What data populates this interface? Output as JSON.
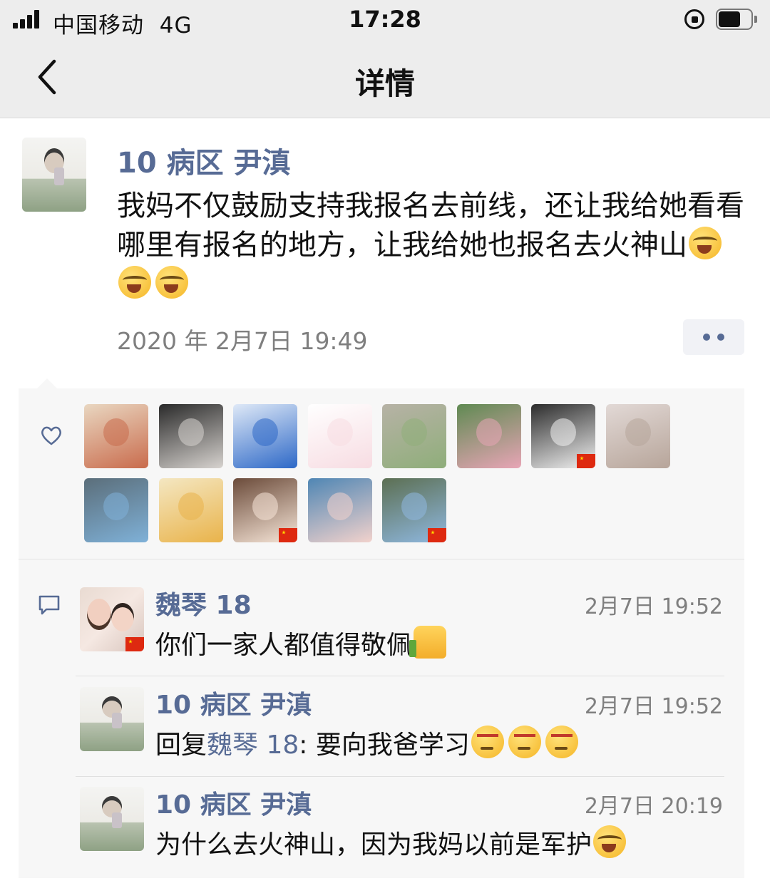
{
  "status_bar": {
    "carrier": "中国移动",
    "network": "4G",
    "time": "17:28"
  },
  "nav": {
    "title": "详情"
  },
  "post": {
    "author": "10 病区 尹滇",
    "text_main": "我妈不仅鼓励支持我报名去前线，还让我给她看看哪里有报名的地方，让我给她也报名去火神山",
    "emojis": [
      "cry-laugh",
      "cry-laugh",
      "cry-laugh"
    ],
    "timestamp": "2020 年 2月7日 19:49"
  },
  "likes": {
    "count_shown": 13,
    "avatars": [
      {
        "id": "like-1",
        "colors": [
          "#c96b4c",
          "#e9d7c1"
        ]
      },
      {
        "id": "like-2",
        "colors": [
          "#d7d3cf",
          "#2a2a2a"
        ]
      },
      {
        "id": "like-3",
        "colors": [
          "#2d68c7",
          "#dfe9f7"
        ]
      },
      {
        "id": "like-4",
        "colors": [
          "#f7dce2",
          "#ffffff"
        ]
      },
      {
        "id": "like-5",
        "colors": [
          "#8fae7a",
          "#b7b2a6"
        ]
      },
      {
        "id": "like-6",
        "colors": [
          "#e8a5b6",
          "#5f8a52"
        ]
      },
      {
        "id": "like-7",
        "colors": [
          "#f2f2f2",
          "#2c2c2c"
        ],
        "flag": true
      },
      {
        "id": "like-8",
        "colors": [
          "#b7a59a",
          "#e2d9d6"
        ]
      },
      {
        "id": "like-9",
        "colors": [
          "#7fb1d8",
          "#5b6e7a"
        ]
      },
      {
        "id": "like-10",
        "colors": [
          "#e9b34a",
          "#f4e7c2"
        ]
      },
      {
        "id": "like-11",
        "colors": [
          "#f7e6d8",
          "#6b4b3a"
        ],
        "flag": true
      },
      {
        "id": "like-12",
        "colors": [
          "#f2d2cc",
          "#4f86b4"
        ]
      },
      {
        "id": "like-13",
        "colors": [
          "#8fb8e0",
          "#5c6f52"
        ],
        "flag": true
      }
    ]
  },
  "comments": [
    {
      "name": "魏琴  18",
      "time": "2月7日 19:52",
      "text": "你们一家人都值得敬佩",
      "emojis": [
        "thumbs-up"
      ],
      "avatar": "weiqin"
    },
    {
      "name": "10 病区 尹滇",
      "time": "2月7日 19:52",
      "reply_prefix": "回复",
      "reply_to": "魏琴  18",
      "text": ": 要向我爸学习",
      "emojis": [
        "angry-face",
        "angry-face",
        "angry-face"
      ],
      "avatar": "yin"
    },
    {
      "name": "10 病区 尹滇",
      "time": "2月7日 20:19",
      "text": "为什么去火神山，因为我妈以前是军护",
      "emojis": [
        "cry-laugh"
      ],
      "avatar": "yin"
    }
  ],
  "colors": {
    "link_name": "#576b95",
    "meta_grey": "#7f7f7f",
    "topbar_bg": "#ededed",
    "panel_bg": "#f7f7f7"
  }
}
